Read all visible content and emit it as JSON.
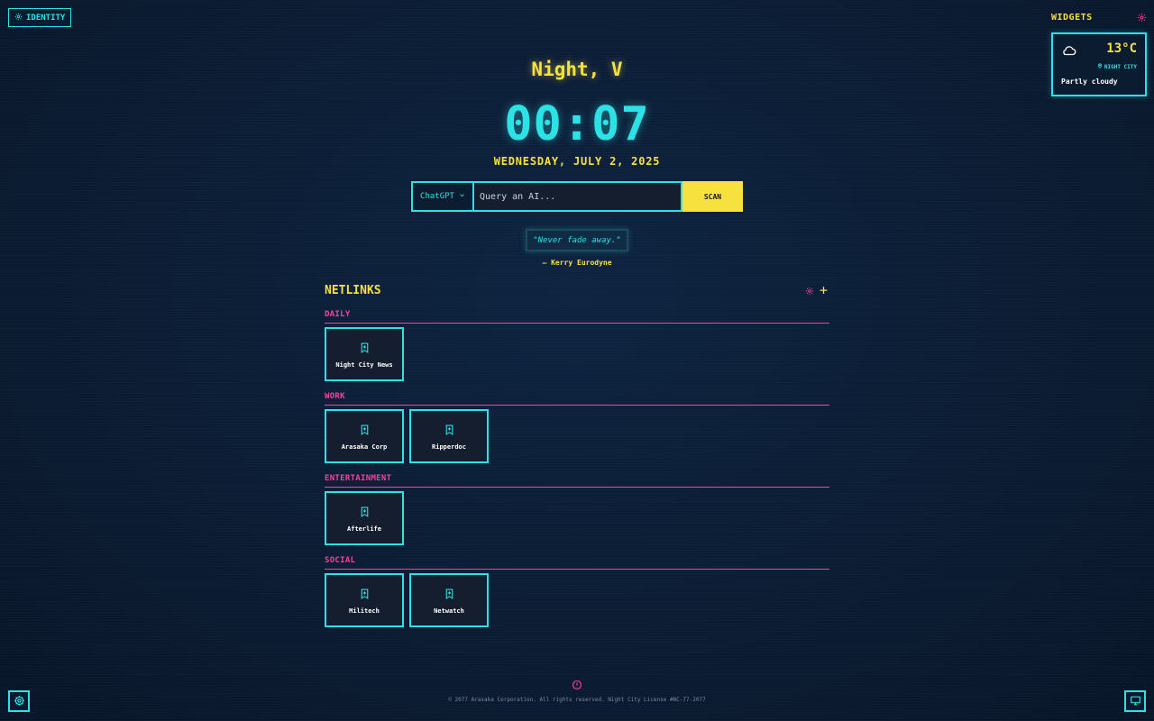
{
  "identity": {
    "label": "IDENTITY"
  },
  "widgets": {
    "title": "WIDGETS",
    "weather": {
      "temp": "13°C",
      "location": "NIGHT CITY",
      "description": "Partly cloudy"
    }
  },
  "greeting": "Night, V",
  "clock": "00:07",
  "date": "WEDNESDAY, JULY 2, 2025",
  "search": {
    "engine": "ChatGPT",
    "placeholder": "Query an AI...",
    "button": "SCAN"
  },
  "quote": {
    "text": "\"Never fade away.\"",
    "author": "— Kerry Eurodyne"
  },
  "netlinks": {
    "title": "NETLINKS",
    "categories": [
      {
        "name": "DAILY",
        "links": [
          {
            "label": "Night City News"
          }
        ]
      },
      {
        "name": "WORK",
        "links": [
          {
            "label": "Arasaka Corp"
          },
          {
            "label": "Ripperdoc"
          }
        ]
      },
      {
        "name": "ENTERTAINMENT",
        "links": [
          {
            "label": "Afterlife"
          }
        ]
      },
      {
        "name": "SOCIAL",
        "links": [
          {
            "label": "Militech"
          },
          {
            "label": "Netwatch"
          }
        ]
      }
    ]
  },
  "footer": {
    "copyright": "© 2077 Arasaka Corporation. All rights reserved. Night City License #NC-77-2077"
  },
  "colors": {
    "accent_cyan": "#2de2e6",
    "accent_yellow": "#f7e13f",
    "accent_pink": "#ff3e9d",
    "background": "#0b1c33"
  },
  "icons": {
    "identity": "gear-icon",
    "widgets_settings": "gear-icon",
    "weather": "cloud-icon",
    "location": "map-pin-icon",
    "engine_dropdown": "chevron-down-icon",
    "netlinks_settings": "gear-icon",
    "netlinks_add": "plus-icon",
    "link_tile": "bookmark-icon",
    "footer_info": "info-icon",
    "bottom_left": "settings-icon",
    "bottom_right": "monitor-icon"
  }
}
